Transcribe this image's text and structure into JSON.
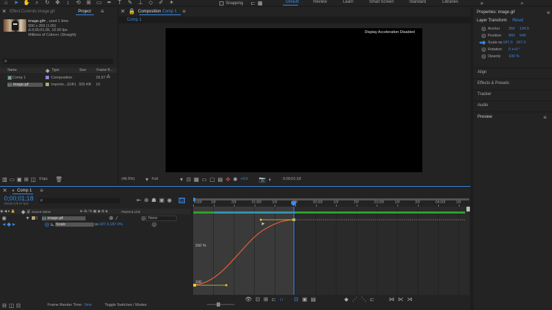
{
  "toolbar": {
    "snapping_label": "Snapping",
    "workspaces": [
      "Default",
      "Review",
      "Learn",
      "Small Screen",
      "Standard",
      "Libraries"
    ],
    "active_workspace": "Default"
  },
  "project_panel": {
    "tab_effect_controls": "Effect Controls image.gif",
    "tab_project": "Project",
    "item_name": "image.gif",
    "item_used": "▾ , used 1 time",
    "item_dims": "500 x 269 (1.00)",
    "item_duration": "Δ 0;00;01;06, 10.00 fps",
    "item_colors": "Millions of Colors+ (Straight)",
    "columns": {
      "name": "Name",
      "type": "Type",
      "size": "Size",
      "frame_rate": "Frame R..."
    },
    "rows": [
      {
        "name": "Comp 1",
        "type": "Composition",
        "size": "",
        "fps": "29.97"
      },
      {
        "name": "image.gif",
        "type": "Importe...(GIF)",
        "size": "325 KB",
        "fps": "10"
      }
    ],
    "bpc": "8 bpc"
  },
  "comp_viewer": {
    "tab_prefix": "Composition",
    "tab_name": "Comp 1",
    "sub_tab": "Comp 1",
    "notice": "Display Acceleration Disabled",
    "zoom": "(46.5%)",
    "resolution": "Full",
    "exposure": "+0.0",
    "timecode": "0;00;01;18"
  },
  "right_panel": {
    "properties_title": "Properties: image.gif",
    "layer_transform": "Layer Transform",
    "reset": "Reset",
    "props": [
      {
        "name": "Anchor",
        "v1": "250",
        "v2": "134.5"
      },
      {
        "name": "Position",
        "v1": "960",
        "v2": "540"
      },
      {
        "name": "Scale",
        "v1": "187.0",
        "v2": "187.0"
      },
      {
        "name": "Rotation",
        "v1": "0 x+0 °",
        "v2": ""
      },
      {
        "name": "Opacity",
        "v1": "100 %",
        "v2": ""
      }
    ],
    "sections": [
      "Align",
      "Effects & Presets",
      "Tracker",
      "Audio",
      "Preview"
    ]
  },
  "timeline": {
    "tab": "Comp 1",
    "timecode": "0;00;01;18",
    "timecode_sub": "00048 (29.97 fps)",
    "col_source": "Source Name",
    "col_parent": "Parent & Link",
    "layer_num": "1",
    "layer_name": "image.gif",
    "parent_value": "None",
    "prop_name": "Scale",
    "prop_value": "187.0,187.0%",
    "ruler": [
      "0:00f",
      "10f",
      "20f",
      "01:00f",
      "10f",
      "20f",
      "02:00f",
      "10f",
      "20f",
      "03:00f",
      "10f",
      "20f",
      "04:00f",
      "10f"
    ],
    "graph_label_150": "150 %",
    "graph_label_100": "100",
    "render_time_label": "Frame Render Time:",
    "render_time_value": "0ms",
    "toggle_label": "Toggle Switches / Modes"
  },
  "colors": {
    "accent": "#3b8ce6",
    "track_green": "#2aa52a",
    "curve": "#e0603a",
    "keyframe_yellow": "#e8d23a"
  }
}
